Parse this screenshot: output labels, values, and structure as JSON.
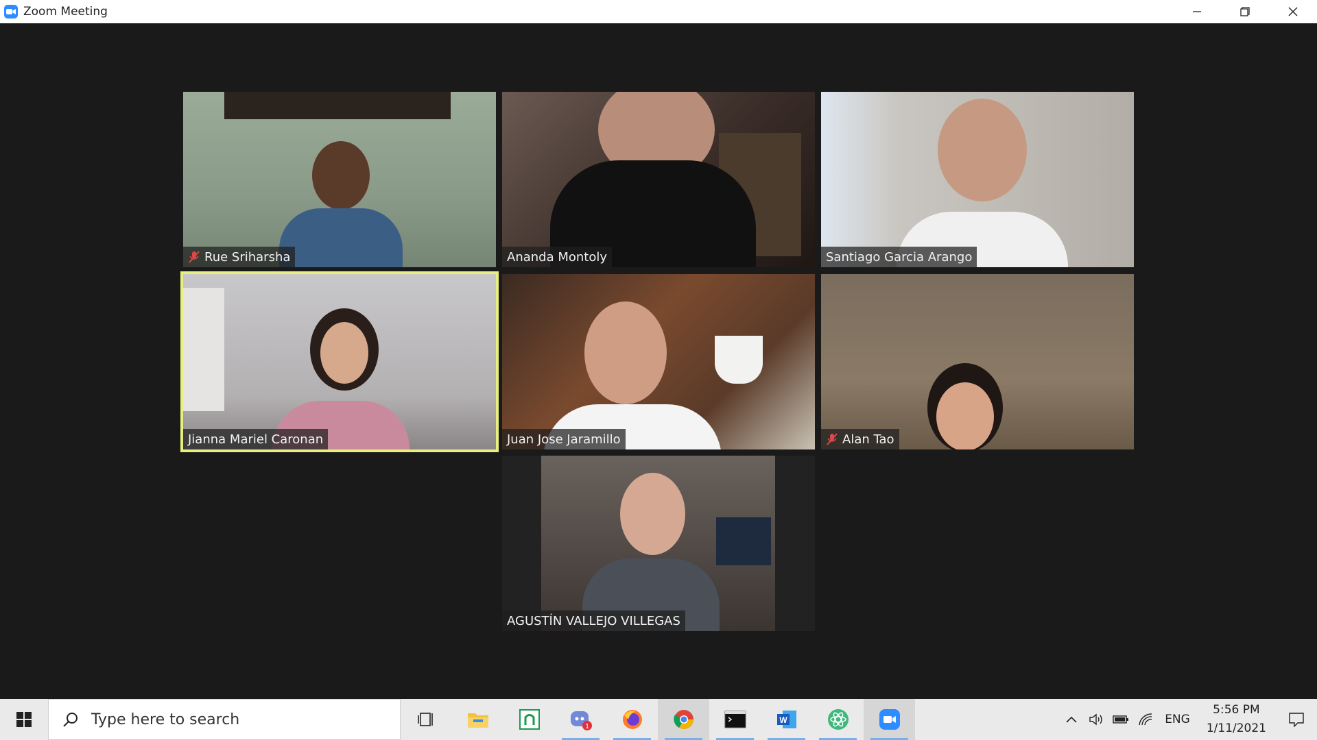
{
  "window": {
    "title": "Zoom Meeting",
    "accent": "#2d8cff"
  },
  "participants": [
    {
      "name": "Rue Sriharsha",
      "muted": true,
      "active": false,
      "bg": "#8fa08c"
    },
    {
      "name": "Ananda Montoly",
      "muted": false,
      "active": false,
      "bg": "#5c4640"
    },
    {
      "name": "Santiago Garcia Arango",
      "muted": false,
      "active": false,
      "bg": "#b7b3ad"
    },
    {
      "name": "Jianna Mariel Caronan",
      "muted": false,
      "active": true,
      "bg": "#b9b6b8"
    },
    {
      "name": "Juan Jose Jaramillo",
      "muted": false,
      "active": false,
      "bg": "#6d4a33"
    },
    {
      "name": "Alan Tao",
      "muted": true,
      "active": false,
      "bg": "#7a6a58"
    },
    {
      "name": "AGUSTÍN VALLEJO VILLEGAS",
      "muted": false,
      "active": false,
      "bg": "#5b5450"
    }
  ],
  "taskbar": {
    "search_placeholder": "Type here to search",
    "apps": [
      "task-view",
      "file-explorer",
      "excalidraw",
      "discord",
      "firefox",
      "chrome",
      "terminal",
      "word",
      "atom",
      "zoom"
    ],
    "discord_badge": "1",
    "language": "ENG",
    "time": "5:56 PM",
    "date": "1/11/2021"
  }
}
